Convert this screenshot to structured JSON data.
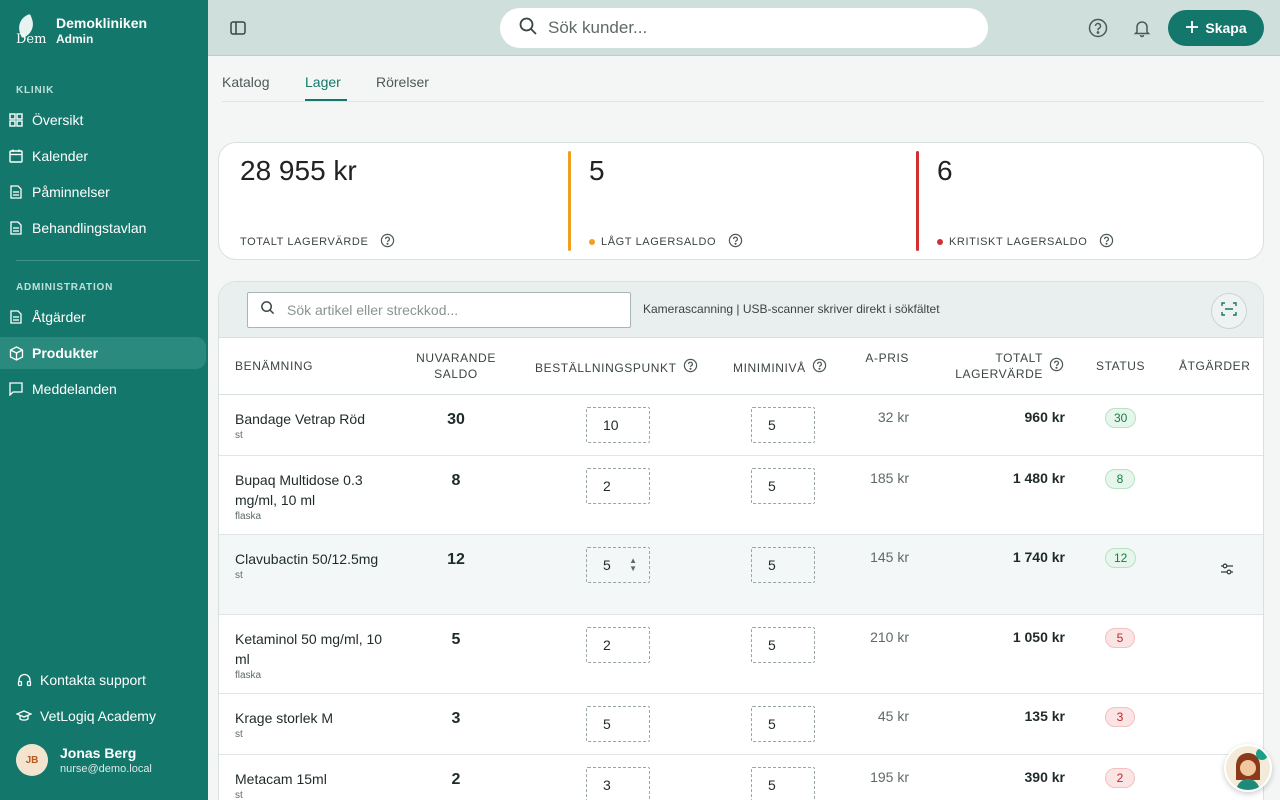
{
  "brand": {
    "name": "Demokliniken",
    "role": "Admin",
    "logo_text": "Dem"
  },
  "nav": {
    "section_klinik": "KLINIK",
    "section_admin": "ADMINISTRATION",
    "items": [
      {
        "label": "Översikt",
        "icon": "grid-icon"
      },
      {
        "label": "Kalender",
        "icon": "calendar-icon"
      },
      {
        "label": "Påminnelser",
        "icon": "document-icon"
      },
      {
        "label": "Behandlingstavlan",
        "icon": "document-icon"
      },
      {
        "label": "Åtgärder",
        "icon": "document-icon"
      },
      {
        "label": "Produkter",
        "icon": "box-icon"
      },
      {
        "label": "Meddelanden",
        "icon": "chat-icon"
      }
    ],
    "support": "Kontakta support",
    "academy": "VetLogiq Academy"
  },
  "user": {
    "initials": "JB",
    "name": "Jonas Berg",
    "email": "nurse@demo.local"
  },
  "topbar": {
    "search_placeholder": "Sök kunder...",
    "create_label": "Skapa"
  },
  "tabs": [
    "Katalog",
    "Lager",
    "Rörelser"
  ],
  "stats": {
    "total_value": "28 955 kr",
    "total_label": "TOTALT LAGERVÄRDE",
    "low_count": "5",
    "low_label": "LÅGT LAGERSALDO",
    "crit_count": "6",
    "crit_label": "KRITISKT LAGERSALDO"
  },
  "toolbar": {
    "search_placeholder": "Sök artikel eller streckkod...",
    "scan_text": "Kamerascanning | USB-scanner skriver direkt i sökfältet"
  },
  "table": {
    "headers": {
      "name": "BENÄMNING",
      "saldo": "NUVARANDE SALDO",
      "order_point": "BESTÄLLNINGSPUNKT",
      "min_level": "MINIMINIVÅ",
      "price": "A-PRIS",
      "total": "TOTALT LAGERVÄRDE",
      "status": "STATUS",
      "actions": "ÅTGÄRDER"
    },
    "rows": [
      {
        "name": "Bandage Vetrap Röd",
        "unit": "st",
        "saldo": "30",
        "order_point": "10",
        "min": "5",
        "price": "32 kr",
        "total": "960 kr",
        "status": "30",
        "status_type": "ok"
      },
      {
        "name": "Bupaq Multidose 0.3 mg/ml, 10 ml",
        "unit": "flaska",
        "saldo": "8",
        "order_point": "2",
        "min": "5",
        "price": "185 kr",
        "total": "1 480 kr",
        "status": "8",
        "status_type": "ok"
      },
      {
        "name": "Clavubactin 50/12.5mg",
        "unit": "st",
        "saldo": "12",
        "order_point": "5",
        "min": "5",
        "price": "145 kr",
        "total": "1 740 kr",
        "status": "12",
        "status_type": "ok"
      },
      {
        "name": "Ketaminol 50 mg/ml, 10 ml",
        "unit": "flaska",
        "saldo": "5",
        "order_point": "2",
        "min": "5",
        "price": "210 kr",
        "total": "1 050 kr",
        "status": "5",
        "status_type": "crit"
      },
      {
        "name": "Krage storlek M",
        "unit": "st",
        "saldo": "3",
        "order_point": "5",
        "min": "5",
        "price": "45 kr",
        "total": "135 kr",
        "status": "3",
        "status_type": "crit"
      },
      {
        "name": "Metacam 15ml",
        "unit": "st",
        "saldo": "2",
        "order_point": "3",
        "min": "5",
        "price": "195 kr",
        "total": "390 kr",
        "status": "2",
        "status_type": "crit"
      }
    ]
  },
  "colors": {
    "accent": "#14776b",
    "low": "#f0a020",
    "critical": "#d23030"
  }
}
